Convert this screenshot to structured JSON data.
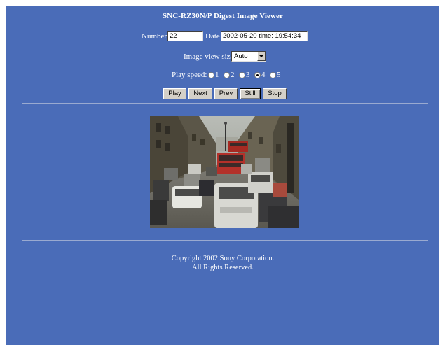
{
  "header": {
    "title": "SNC-RZ30N/P  Digest Image Viewer"
  },
  "number_field": {
    "label": "Number",
    "value": "22"
  },
  "date_field": {
    "label": "Date",
    "value": "2002-05-20  time: 19:54:34"
  },
  "view_size": {
    "label": "Image view size:",
    "selected": "Auto"
  },
  "play_speed": {
    "label": "Play speed:",
    "options": [
      "1",
      "2",
      "3",
      "4",
      "5"
    ],
    "selected": "4"
  },
  "buttons": {
    "play": "Play",
    "next": "Next",
    "prev": "Prev",
    "still": "Still",
    "stop": "Stop"
  },
  "image": {
    "description": "street-traffic-photo"
  },
  "footer": {
    "copyright": "Copyright 2002 Sony Corporation.",
    "rights": "All Rights Reserved."
  },
  "colors": {
    "background": "#4a6cb8",
    "button_face": "#d4d0c8",
    "text": "#ffffff"
  }
}
